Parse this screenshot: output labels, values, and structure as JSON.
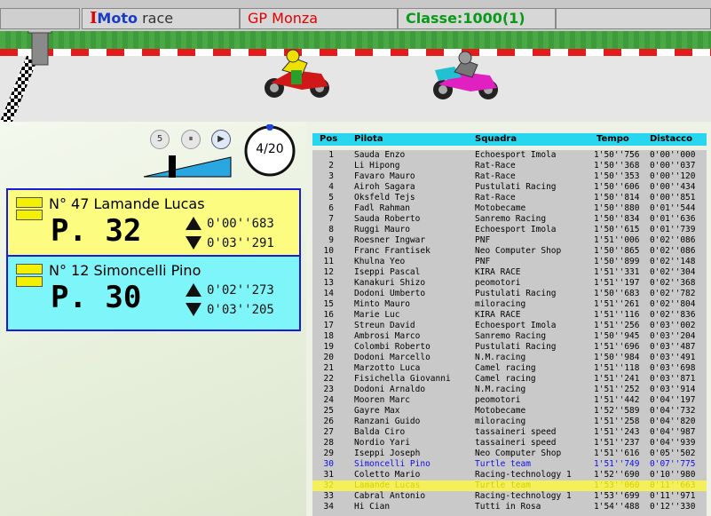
{
  "topbar": {
    "logo_i": "I",
    "logo_moto": "Moto",
    "logo_race": " race",
    "gp": "GP Monza",
    "classe": "Classe:1000(1)",
    "empty": ""
  },
  "controls": {
    "speed_label": "5",
    "pause_icon": "⏸",
    "play_icon": "▶",
    "lap": "4/20",
    "lap_progress": 0.2
  },
  "cards": [
    {
      "name": "N° 47 Lamande Lucas",
      "position": "P. 32",
      "gap_ahead": "0'00''683",
      "gap_behind": "0'03''291"
    },
    {
      "name": "N° 12 Simoncelli Pino",
      "position": "P. 30",
      "gap_ahead": "0'02''273",
      "gap_behind": "0'03''205"
    }
  ],
  "standings": {
    "headers": {
      "pos": "Pos",
      "pilota": "Pilota",
      "squadra": "Squadra",
      "tempo": "Tempo",
      "distacco": "Distacco"
    },
    "rows": [
      {
        "pos": "1",
        "pilota": "Sauda Enzo",
        "squadra": "Echoesport Imola",
        "tempo": "1'50''756",
        "distacco": "0'00''000"
      },
      {
        "pos": "2",
        "pilota": "Li Hipong",
        "squadra": "Rat-Race",
        "tempo": "1'50''368",
        "distacco": "0'00''037"
      },
      {
        "pos": "3",
        "pilota": "Favaro Mauro",
        "squadra": "Rat-Race",
        "tempo": "1'50''353",
        "distacco": "0'00''120"
      },
      {
        "pos": "4",
        "pilota": "Airoh Sagara",
        "squadra": "Pustulati Racing",
        "tempo": "1'50''606",
        "distacco": "0'00''434"
      },
      {
        "pos": "5",
        "pilota": "Oksfeld Tejs",
        "squadra": "Rat-Race",
        "tempo": "1'50''814",
        "distacco": "0'00''851"
      },
      {
        "pos": "6",
        "pilota": "Fadl Rahman",
        "squadra": "Motobecame",
        "tempo": "1'50''880",
        "distacco": "0'01''544"
      },
      {
        "pos": "7",
        "pilota": "Sauda Roberto",
        "squadra": "Sanremo Racing",
        "tempo": "1'50''834",
        "distacco": "0'01''636"
      },
      {
        "pos": "8",
        "pilota": "Ruggi Mauro",
        "squadra": "Echoesport Imola",
        "tempo": "1'50''615",
        "distacco": "0'01''739"
      },
      {
        "pos": "9",
        "pilota": "Roesner Ingwar",
        "squadra": "PNF",
        "tempo": "1'51''006",
        "distacco": "0'02''086"
      },
      {
        "pos": "10",
        "pilota": "Franc Frantisek",
        "squadra": "Neo Computer Shop",
        "tempo": "1'50''865",
        "distacco": "0'02''086"
      },
      {
        "pos": "11",
        "pilota": "Khulna Yeo",
        "squadra": "PNF",
        "tempo": "1'50''899",
        "distacco": "0'02''148"
      },
      {
        "pos": "12",
        "pilota": "Iseppi Pascal",
        "squadra": "KIRA RACE",
        "tempo": "1'51''331",
        "distacco": "0'02''304"
      },
      {
        "pos": "13",
        "pilota": "Kanakuri Shizo",
        "squadra": "peomotori",
        "tempo": "1'51''197",
        "distacco": "0'02''368"
      },
      {
        "pos": "14",
        "pilota": "Dodoni Umberto",
        "squadra": "Pustulati Racing",
        "tempo": "1'50''683",
        "distacco": "0'02''782"
      },
      {
        "pos": "15",
        "pilota": "Minto Mauro",
        "squadra": "miloracing",
        "tempo": "1'51''261",
        "distacco": "0'02''804"
      },
      {
        "pos": "16",
        "pilota": "Marie Luc",
        "squadra": "KIRA RACE",
        "tempo": "1'51''116",
        "distacco": "0'02''836"
      },
      {
        "pos": "17",
        "pilota": "Streun David",
        "squadra": "Echoesport Imola",
        "tempo": "1'51''256",
        "distacco": "0'03''002"
      },
      {
        "pos": "18",
        "pilota": "Ambrosi Marco",
        "squadra": "Sanremo Racing",
        "tempo": "1'50''945",
        "distacco": "0'03''204"
      },
      {
        "pos": "19",
        "pilota": "Colombi Roberto",
        "squadra": "Pustulati Racing",
        "tempo": "1'51''696",
        "distacco": "0'03''487"
      },
      {
        "pos": "20",
        "pilota": "Dodoni Marcello",
        "squadra": "N.M.racing",
        "tempo": "1'50''984",
        "distacco": "0'03''491"
      },
      {
        "pos": "21",
        "pilota": "Marzotto Luca",
        "squadra": "Camel racing",
        "tempo": "1'51''118",
        "distacco": "0'03''698"
      },
      {
        "pos": "22",
        "pilota": "Fisichella Giovanni",
        "squadra": "Camel racing",
        "tempo": "1'51''241",
        "distacco": "0'03''871"
      },
      {
        "pos": "23",
        "pilota": "Dodoni Arnaldo",
        "squadra": "N.M.racing",
        "tempo": "1'51''252",
        "distacco": "0'03''914"
      },
      {
        "pos": "24",
        "pilota": "Mooren Marc",
        "squadra": "peomotori",
        "tempo": "1'51''442",
        "distacco": "0'04''197"
      },
      {
        "pos": "25",
        "pilota": "Gayre Max",
        "squadra": "Motobecame",
        "tempo": "1'52''589",
        "distacco": "0'04''732"
      },
      {
        "pos": "26",
        "pilota": "Ranzani Guido",
        "squadra": "miloracing",
        "tempo": "1'51''258",
        "distacco": "0'04''820"
      },
      {
        "pos": "27",
        "pilota": "Balda Ciro",
        "squadra": "tassaineri speed",
        "tempo": "1'51''243",
        "distacco": "0'04''987"
      },
      {
        "pos": "28",
        "pilota": "Nordio Yari",
        "squadra": "tassaineri speed",
        "tempo": "1'51''237",
        "distacco": "0'04''939"
      },
      {
        "pos": "29",
        "pilota": "Iseppi Joseph",
        "squadra": "Neo Computer Shop",
        "tempo": "1'51''616",
        "distacco": "0'05''502"
      },
      {
        "pos": "30",
        "pilota": "Simoncelli Pino",
        "squadra": "Turtle team",
        "tempo": "1'51''749",
        "distacco": "0'07''775",
        "highlight": "blue"
      },
      {
        "pos": "31",
        "pilota": "Coletto Mario",
        "squadra": "Racing-technology 1",
        "tempo": "1'52''690",
        "distacco": "0'10''980"
      },
      {
        "pos": "32",
        "pilota": "Lamande Lucas",
        "squadra": "Turtle team",
        "tempo": "1'53''060",
        "distacco": "0'11''663",
        "highlight": "yellow"
      },
      {
        "pos": "33",
        "pilota": "Cabral Antonio",
        "squadra": "Racing-technology 1",
        "tempo": "1'53''699",
        "distacco": "0'11''971"
      },
      {
        "pos": "34",
        "pilota": "Hi Cian",
        "squadra": "Tutti in Rosa",
        "tempo": "1'54''488",
        "distacco": "0'12''330"
      }
    ]
  }
}
